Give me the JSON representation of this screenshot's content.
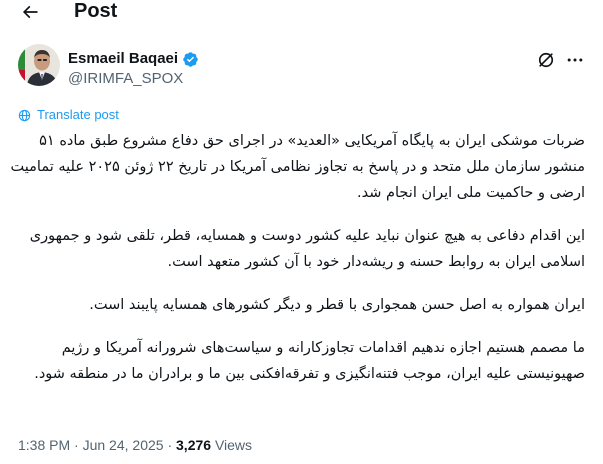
{
  "header": {
    "back_icon": "arrow-left-icon",
    "title": "Post"
  },
  "author": {
    "display_name": "Esmaeil Baqaei",
    "handle": "@IRIMFA_SPOX",
    "verified_icon": "verified-badge-icon",
    "verified_color": "#1d9bf0"
  },
  "actions": {
    "grok_icon": "grok-icon",
    "more_icon": "more-horizontal-icon"
  },
  "translate": {
    "label": "Translate post",
    "icon": "globe-icon",
    "color": "#1d9bf0"
  },
  "body": {
    "paragraphs": [
      "ضربات موشکی ایران به پایگاه آمریکایی «العدید» در اجرای حق دفاع مشروع طبق ماده ۵۱ منشور سازمان ملل متحد و در پاسخ به تجاوز نظامی آمریکا در تاریخ ۲۲ ژوئن ۲۰۲۵ علیه تمامیت ارضی و حاکمیت ملی ایران انجام شد.",
      "این اقدام دفاعی به هیچ عنوان نباید علیه کشور دوست و همسایه، قطر، تلقی شود و جمهوری اسلامی ایران به روابط حسنه و ریشه‌دار خود با آن کشور متعهد است.",
      "ایران همواره به اصل حسن همجواری با قطر و دیگر کشورهای همسایه پایبند است.",
      "ما مصمم هستیم اجازه ندهیم اقدامات تجاوزکارانه و سیاست‌های شرورانه آمریکا و رژیم صهیونیستی علیه ایران، موجب فتنه‌انگیزی و تفرقه‌افکنی بین ما و برادران ما در منطقه شود."
    ]
  },
  "meta": {
    "time": "1:38 PM",
    "separator": "·",
    "date": "Jun 24, 2025",
    "views_count": "3,276",
    "views_label": "Views"
  }
}
